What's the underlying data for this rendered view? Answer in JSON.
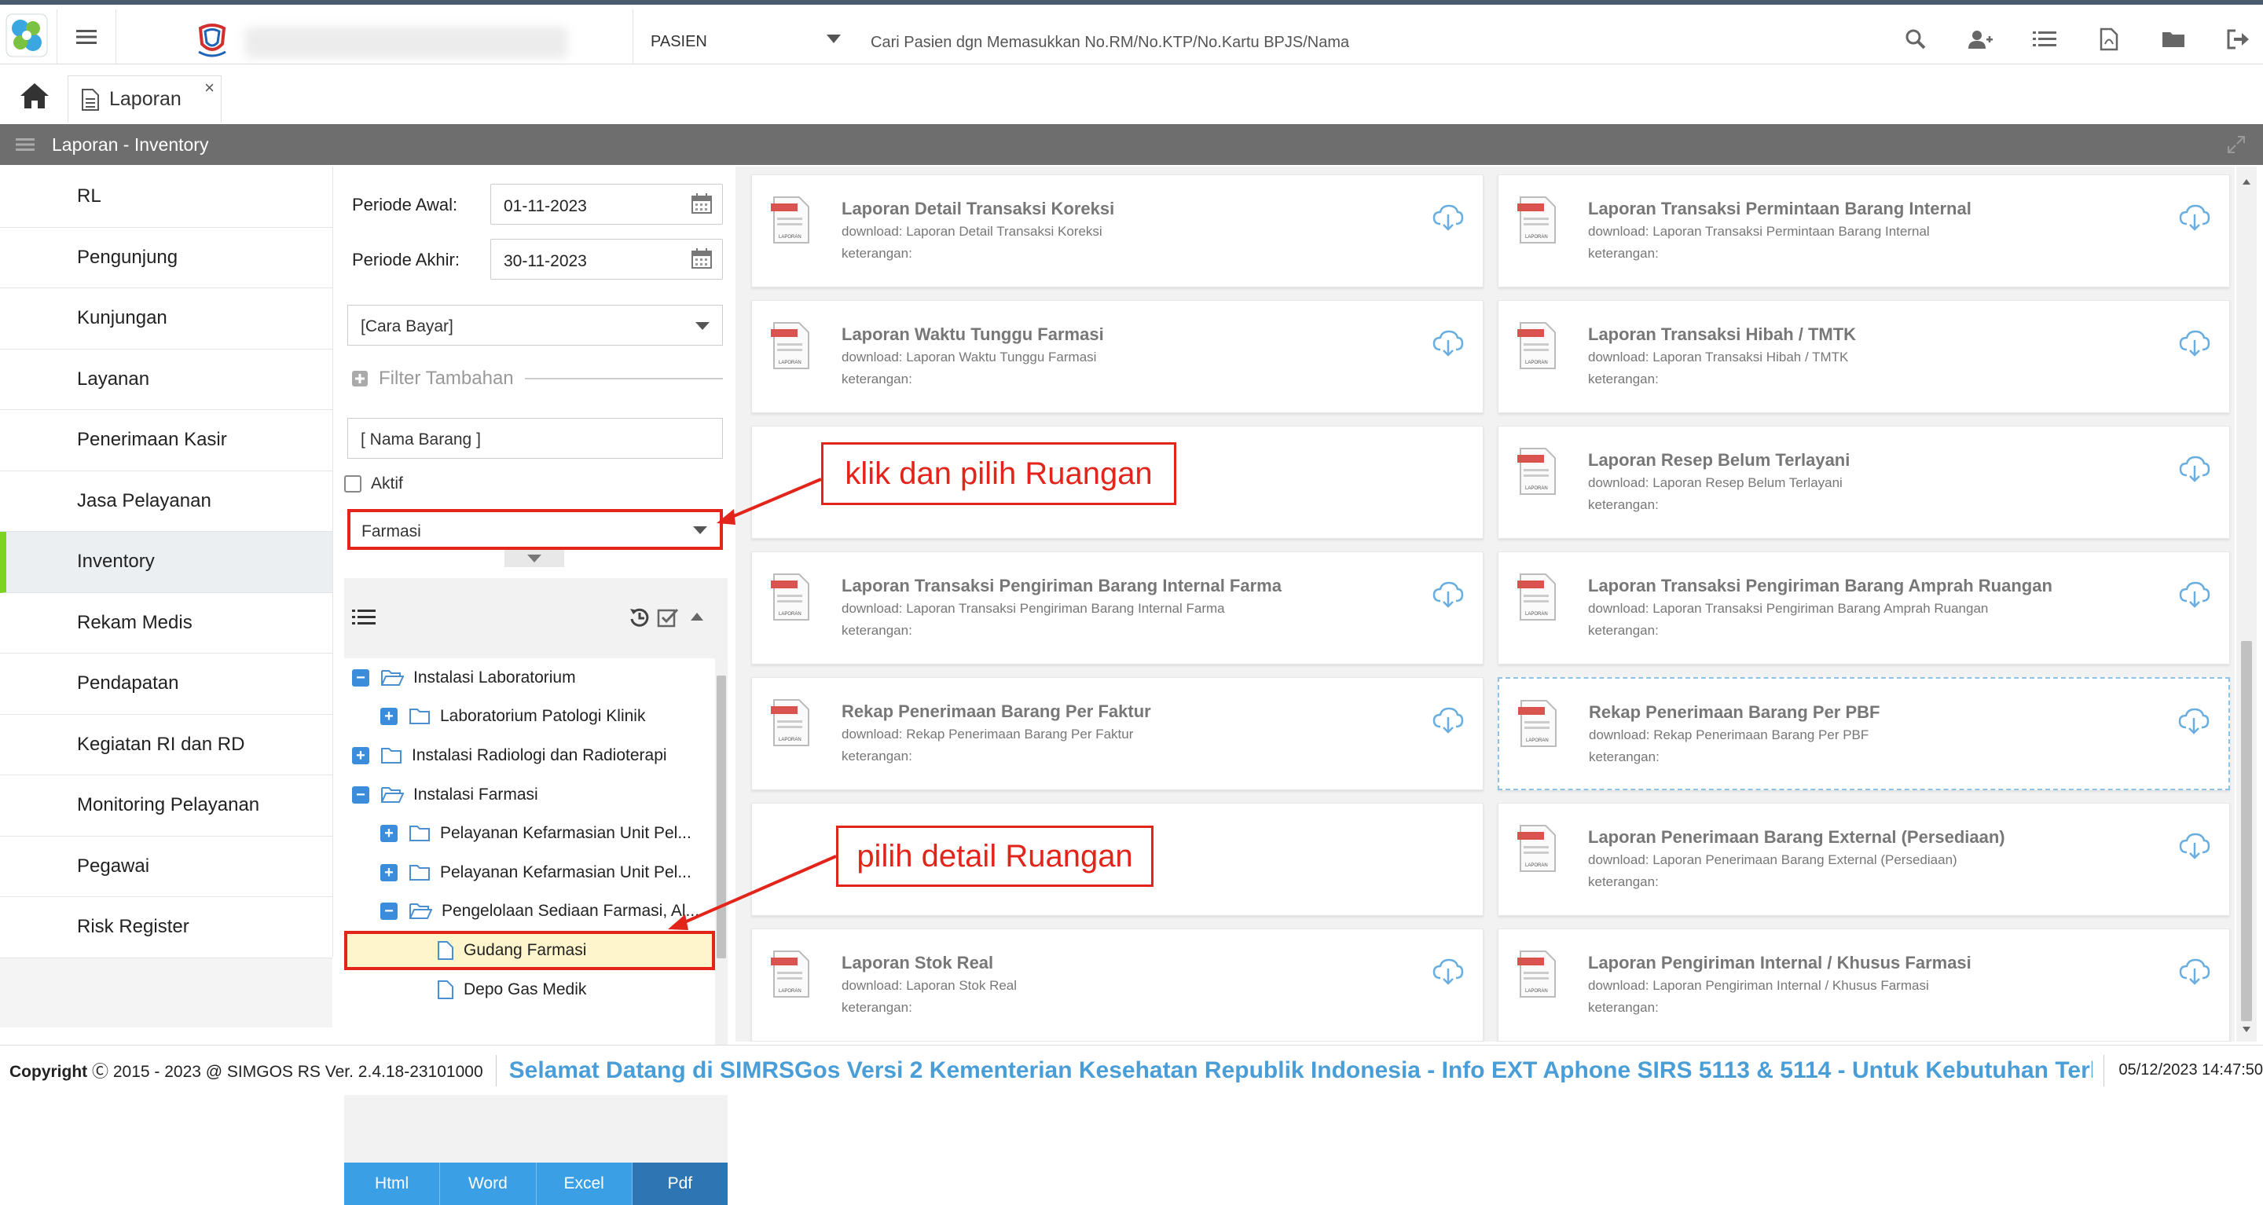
{
  "topbar": {
    "search_type": "PASIEN",
    "search_placeholder": "Cari Pasien dgn Memasukkan No.RM/No.KTP/No.Kartu BPJS/Nama",
    "icons": [
      "search-icon",
      "add-user-icon",
      "list-icon",
      "pdf-icon",
      "folder-icon",
      "logout-icon"
    ]
  },
  "tabs": [
    {
      "label": "Laporan",
      "close": "×"
    }
  ],
  "header": {
    "title": "Laporan - Inventory"
  },
  "sidebar": {
    "items": [
      {
        "label": "RL"
      },
      {
        "label": "Pengunjung"
      },
      {
        "label": "Kunjungan"
      },
      {
        "label": "Layanan"
      },
      {
        "label": "Penerimaan Kasir"
      },
      {
        "label": "Jasa Pelayanan"
      },
      {
        "label": "Inventory",
        "active": true
      },
      {
        "label": "Rekam Medis"
      },
      {
        "label": "Pendapatan"
      },
      {
        "label": "Kegiatan RI dan RD"
      },
      {
        "label": "Monitoring Pelayanan"
      },
      {
        "label": "Pegawai"
      },
      {
        "label": "Risk Register"
      }
    ]
  },
  "filter": {
    "periode_awal_label": "Periode Awal:",
    "periode_awal_value": "01-11-2023",
    "periode_akhir_label": "Periode Akhir:",
    "periode_akhir_value": "30-11-2023",
    "cara_bayar": "[Cara Bayar]",
    "filter_tambahan": "Filter Tambahan",
    "nama_barang_placeholder": "[ Nama Barang ]",
    "aktif_label": "Aktif",
    "ruangan_value": "Farmasi"
  },
  "tree": {
    "nodes": [
      {
        "label": "Instalasi Laboratorium",
        "level": 0,
        "toggle": "−",
        "open": true
      },
      {
        "label": "Laboratorium Patologi Klinik",
        "level": 1,
        "toggle": "+",
        "open": false
      },
      {
        "label": "Instalasi Radiologi dan Radioterapi",
        "level": 0,
        "toggle": "+",
        "open": false
      },
      {
        "label": "Instalasi Farmasi",
        "level": 0,
        "toggle": "−",
        "open": true
      },
      {
        "label": "Pelayanan Kefarmasian Unit Pel...",
        "level": 1,
        "toggle": "+",
        "open": false
      },
      {
        "label": "Pelayanan Kefarmasian Unit Pel...",
        "level": 1,
        "toggle": "+",
        "open": false
      },
      {
        "label": "Pengelolaan Sediaan Farmasi, Al...",
        "level": 1,
        "toggle": "−",
        "open": true
      },
      {
        "label": "Gudang Farmasi",
        "level": 2,
        "toggle": "",
        "leaf": true,
        "selected": true
      },
      {
        "label": "Depo Gas Medik",
        "level": 2,
        "toggle": "",
        "leaf": true
      }
    ]
  },
  "export": {
    "html": "Html",
    "word": "Word",
    "excel": "Excel",
    "pdf": "Pdf"
  },
  "reports": {
    "left": [
      {
        "title": "Laporan Detail Transaksi Koreksi",
        "download": "download: Laporan Detail Transaksi Koreksi",
        "keterangan": "keterangan:"
      },
      {
        "title": "Laporan Waktu Tunggu Farmasi",
        "download": "download: Laporan Waktu Tunggu Farmasi",
        "keterangan": "keterangan:"
      },
      null,
      {
        "title": "Laporan Transaksi Pengiriman Barang Internal Farma",
        "download": "download: Laporan Transaksi Pengiriman Barang Internal Farma",
        "keterangan": "keterangan:"
      },
      {
        "title": "Rekap Penerimaan Barang Per Faktur",
        "download": "download: Rekap Penerimaan Barang Per Faktur",
        "keterangan": "keterangan:"
      },
      null,
      {
        "title": "Laporan Stok Real",
        "download": "download: Laporan Stok Real",
        "keterangan": "keterangan:"
      }
    ],
    "right": [
      {
        "title": "Laporan Transaksi Permintaan Barang Internal",
        "download": "download: Laporan Transaksi Permintaan Barang Internal",
        "keterangan": "keterangan:"
      },
      {
        "title": "Laporan Transaksi Hibah / TMTK",
        "download": "download: Laporan Transaksi Hibah / TMTK",
        "keterangan": "keterangan:"
      },
      {
        "title": "Laporan Resep Belum Terlayani",
        "download": "download: Laporan Resep Belum Terlayani",
        "keterangan": "keterangan:"
      },
      {
        "title": "Laporan Transaksi Pengiriman Barang Amprah Ruangan",
        "download": "download: Laporan Transaksi Pengiriman Barang Amprah Ruangan",
        "keterangan": "keterangan:"
      },
      {
        "title": "Rekap Penerimaan Barang Per PBF",
        "download": "download: Rekap Penerimaan Barang Per PBF",
        "keterangan": "keterangan:"
      },
      {
        "title": "Laporan Penerimaan Barang External (Persediaan)",
        "download": "download: Laporan Penerimaan Barang External (Persediaan)",
        "keterangan": "keterangan:"
      },
      {
        "title": "Laporan Pengiriman Internal / Khusus Farmasi",
        "download": "download: Laporan Pengiriman Internal / Khusus Farmasi",
        "keterangan": "keterangan:"
      }
    ],
    "file_icon_label": "LAPORAN"
  },
  "annotations": {
    "ruangan": "klik dan pilih Ruangan",
    "detail": "pilih detail Ruangan"
  },
  "footer": {
    "copyright_word": "Copyright",
    "copyright_rest": "2015 - 2023 @ SIMGOS RS Ver. 2.4.18-23101000",
    "marquee": "Selamat Datang di SIMRSGos Versi 2 Kementerian Kesehatan Republik Indonesia - Info EXT Aphone SIRS 5113 & 5114 - Untuk Kebutuhan Terkait Ha",
    "datetime": "05/12/2023 14:47:50"
  }
}
